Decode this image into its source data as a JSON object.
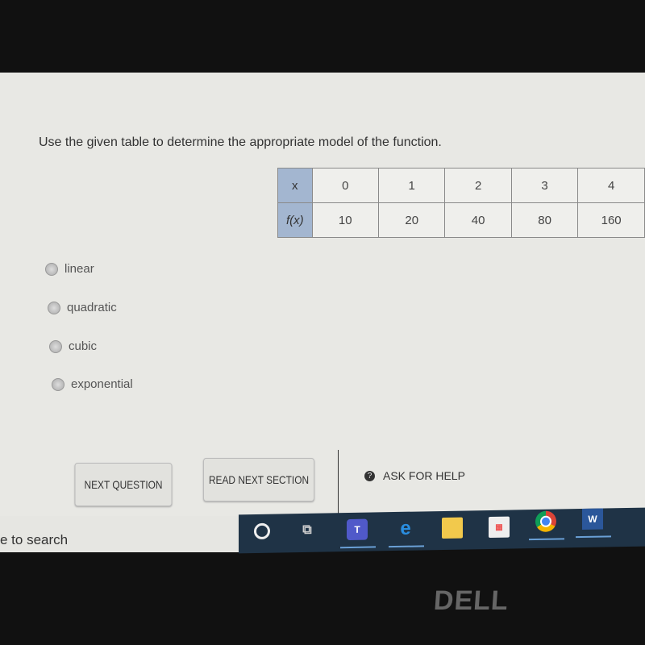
{
  "question": "Use the given table to determine the appropriate model of the function.",
  "table": {
    "row_headers": [
      "x",
      "f(x)"
    ],
    "x": [
      "0",
      "1",
      "2",
      "3",
      "4"
    ],
    "fx": [
      "10",
      "20",
      "40",
      "80",
      "160"
    ]
  },
  "options": [
    {
      "label": "linear",
      "selected": false
    },
    {
      "label": "quadratic",
      "selected": false
    },
    {
      "label": "cubic",
      "selected": false
    },
    {
      "label": "exponential",
      "selected": false
    }
  ],
  "buttons": {
    "next_question": "NEXT QUESTION",
    "read_next_section": "READ NEXT SECTION",
    "ask_for_help": "ASK FOR HELP"
  },
  "taskbar": {
    "search_text": "e to search",
    "icons": [
      "cortana-icon",
      "task-view-icon",
      "teams-icon",
      "edge-icon",
      "file-explorer-icon",
      "store-icon",
      "chrome-icon",
      "word-icon"
    ]
  },
  "brand": "DELL"
}
